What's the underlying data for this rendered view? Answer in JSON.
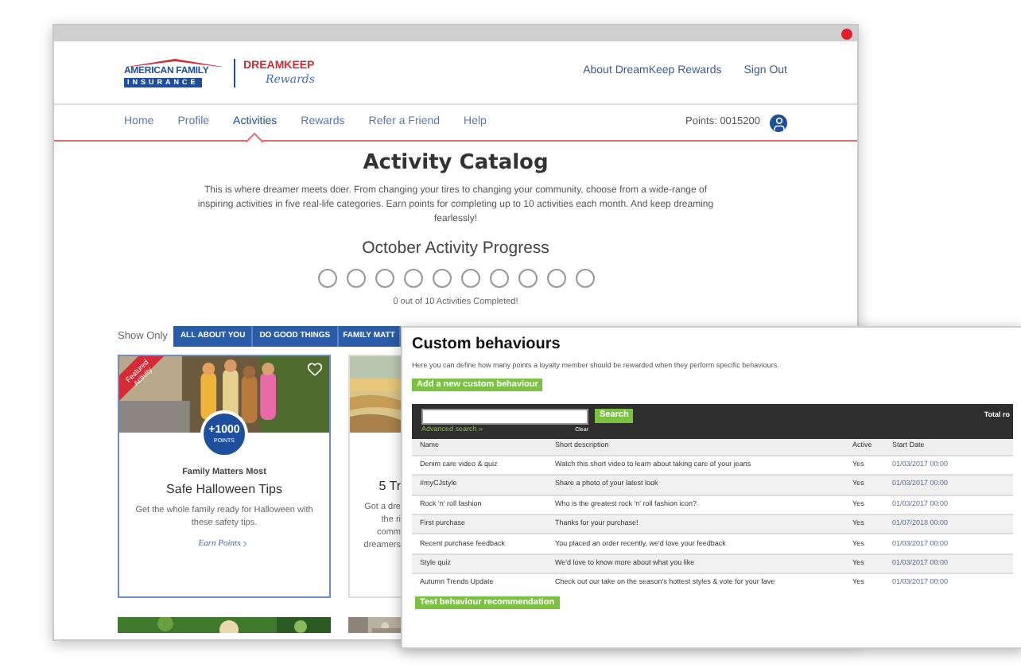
{
  "back_window": {
    "logo": {
      "line1": "AMERICAN FAMILY",
      "line2": "INSURANCE",
      "brand": "DREAMKEEP",
      "brand_sub": "Rewards"
    },
    "header_links": [
      "About DreamKeep Rewards",
      "Sign Out"
    ],
    "nav": [
      {
        "label": "Home",
        "selected": false
      },
      {
        "label": "Profile",
        "selected": false
      },
      {
        "label": "Activities",
        "selected": true
      },
      {
        "label": "Rewards",
        "selected": false
      },
      {
        "label": "Refer a Friend",
        "selected": false
      },
      {
        "label": "Help",
        "selected": false
      }
    ],
    "points": "Points: 0015200",
    "title": "Activity Catalog",
    "intro": "This is where dreamer meets doer. From changing your tires to changing your community, choose from a wide-range of inspiring activities in five real-life categories. Earn points for completing up to 10 activities each month. And keep dreaming fearlessly!",
    "progress_title": "October Activity Progress",
    "progress": [
      {
        "done": false
      },
      {
        "done": false
      },
      {
        "done": false
      },
      {
        "done": false
      },
      {
        "done": false
      },
      {
        "done": false
      },
      {
        "done": false
      },
      {
        "done": false
      },
      {
        "done": false
      },
      {
        "done": false
      }
    ],
    "progress_text": "0 out of 10 Activities Completed!",
    "filter_label": "Show Only",
    "filters": [
      "ALL ABOUT YOU",
      "DO GOOD THINGS",
      "FAMILY MATT"
    ],
    "cards": [
      {
        "featured": true,
        "ribbon": "Featured Activity",
        "badge_value": "+1000",
        "badge_unit": "POINTS",
        "category": "Family Matters Most",
        "title": "Safe Halloween Tips",
        "description": "Get the whole family ready for Halloween with these safety tips.",
        "link": "Earn Points"
      },
      {
        "featured": false,
        "title": "5 Tr",
        "description_lines": [
          "Got a dre",
          "the ri",
          "comm",
          "dreamers"
        ]
      }
    ]
  },
  "overlay": {
    "title": "Custom behaviours",
    "subtitle": "Here you can define how many points a loyalty member should be rewarded when they perform specific behaviours.",
    "add_button": "Add a new custom behaviour",
    "search_button": "Search",
    "advanced_search": "Advanced search »",
    "clear": "Clear",
    "total": "Total ro",
    "columns": [
      "Name",
      "Short description",
      "Active",
      "Start Date"
    ],
    "rows": [
      [
        "Denim care video & quiz",
        "Watch this short video to learn about taking care of your jeans",
        "Yes",
        "01/03/2017 00:00"
      ],
      [
        "#myCJstyle",
        "Share a photo of your latest look",
        "Yes",
        "01/03/2017 00:00"
      ],
      [
        "Rock 'n' roll fashion",
        "Who is the greatest rock 'n' roll fashion icon?",
        "Yes",
        "01/03/2017 00:00"
      ],
      [
        "First purchase",
        "Thanks for your purchase!",
        "Yes",
        "01/07/2018 00:00"
      ],
      [
        "Recent purchase feedback",
        "You placed an order recently, we'd love your feedback",
        "Yes",
        "01/03/2017 00:00"
      ],
      [
        "Style quiz",
        "We'd love to know more about what you like",
        "Yes",
        "01/03/2017 00:00"
      ],
      [
        "Autumn Trends Update",
        "Check out our take on the season's hottest styles & vote for your fave",
        "Yes",
        "01/03/2017 00:00"
      ]
    ],
    "test_button": "Test behaviour recommendation"
  }
}
